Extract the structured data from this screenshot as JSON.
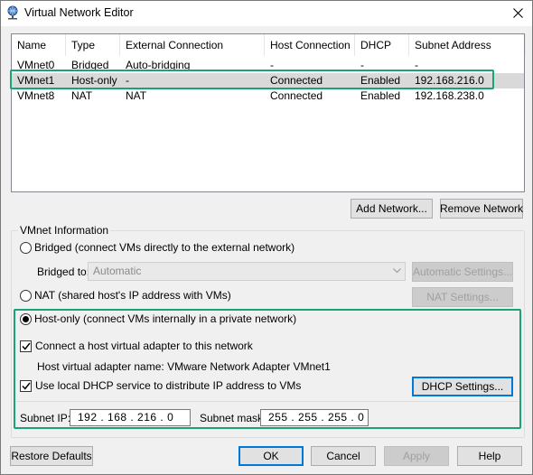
{
  "window": {
    "title": "Virtual Network Editor"
  },
  "networks": {
    "columns": [
      "Name",
      "Type",
      "External Connection",
      "Host Connection",
      "DHCP",
      "Subnet Address"
    ],
    "rows": [
      [
        "VMnet0",
        "Bridged",
        "Auto-bridging",
        "-",
        "-",
        "-"
      ],
      [
        "VMnet1",
        "Host-only",
        "-",
        "Connected",
        "Enabled",
        "192.168.216.0"
      ],
      [
        "VMnet8",
        "NAT",
        "NAT",
        "Connected",
        "Enabled",
        "192.168.238.0"
      ]
    ],
    "selected_index": 1
  },
  "buttons": {
    "add_network": "Add Network...",
    "remove_network": "Remove Network",
    "automatic_settings": "Automatic Settings...",
    "nat_settings": "NAT Settings...",
    "dhcp_settings": "DHCP Settings...",
    "restore_defaults": "Restore Defaults",
    "ok": "OK",
    "cancel": "Cancel",
    "apply": "Apply",
    "help": "Help"
  },
  "vmnet_info": {
    "group_label": "VMnet Information",
    "bridged_label": "Bridged (connect VMs directly to the external network)",
    "bridged_to_label": "Bridged to:",
    "bridged_to_value": "Automatic",
    "nat_label": "NAT (shared host's IP address with VMs)",
    "host_only_label": "Host-only (connect VMs internally in a private network)",
    "selected_mode": "host-only",
    "connect_adapter_label": "Connect a host virtual adapter to this network",
    "connect_adapter_checked": true,
    "adapter_name_label": "Host virtual adapter name: VMware Network Adapter VMnet1",
    "dhcp_label": "Use local DHCP service to distribute IP address to VMs",
    "dhcp_checked": true,
    "subnet_ip_label": "Subnet IP:",
    "subnet_ip_value": "192 . 168 . 216 .  0",
    "subnet_mask_label": "Subnet mask:",
    "subnet_mask_value": "255 . 255 . 255 .  0"
  },
  "colors": {
    "highlight": "#1aa37a",
    "selection": "#d9d9d9",
    "default_border": "#0078d7"
  },
  "icons": {
    "app": "network-globe-icon",
    "close": "close-icon",
    "dropdown": "chevron-down-icon",
    "checkmark": "checkmark-icon"
  }
}
